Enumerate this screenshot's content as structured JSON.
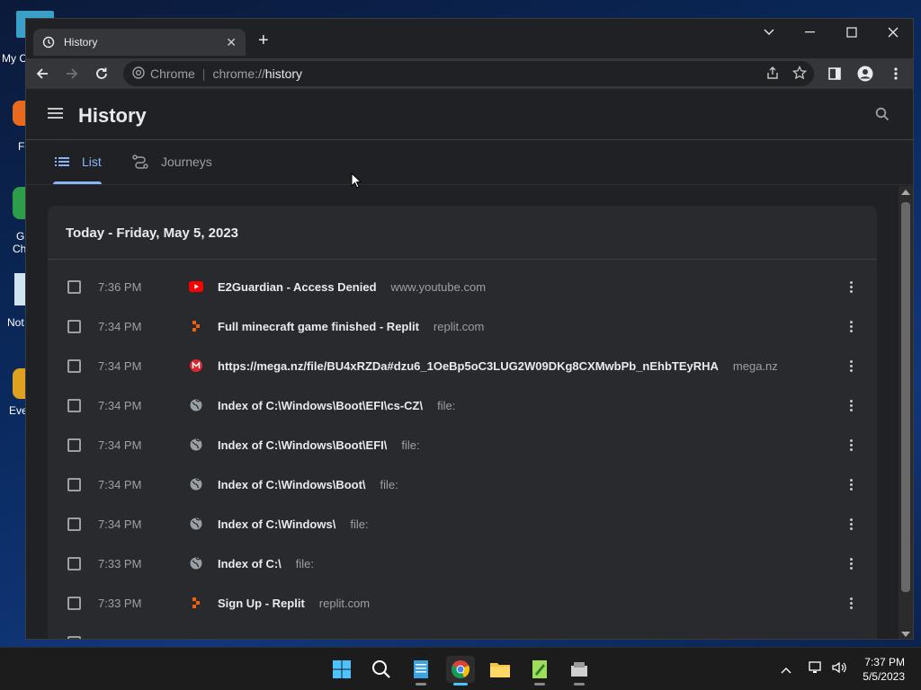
{
  "desktop": {
    "labels": [
      "My C",
      "F",
      "G",
      "Ch",
      "Not",
      "Eve"
    ]
  },
  "browser": {
    "tab_title": "History",
    "omnibox": {
      "site_label": "Chrome",
      "url_scheme": "chrome://",
      "url_host": "history"
    }
  },
  "history": {
    "page_title": "History",
    "tabs": [
      {
        "label": "List",
        "active": true
      },
      {
        "label": "Journeys",
        "active": false
      }
    ],
    "date_heading": "Today - Friday, May 5, 2023",
    "entries": [
      {
        "time": "7:36 PM",
        "title": "E2Guardian - Access Denied",
        "domain": "www.youtube.com",
        "icon": "youtube-icon"
      },
      {
        "time": "7:34 PM",
        "title": "Full minecraft game finished - Replit",
        "domain": "replit.com",
        "icon": "replit-icon"
      },
      {
        "time": "7:34 PM",
        "title": "https://mega.nz/file/BU4xRZDa#dzu6_1OeBp5oC3LUG2W09DKg8CXMwbPb_nEhbTEyRHA",
        "domain": "mega.nz",
        "icon": "mega-icon"
      },
      {
        "time": "7:34 PM",
        "title": "Index of C:\\Windows\\Boot\\EFI\\cs-CZ\\",
        "domain": "file:",
        "icon": "globe-icon"
      },
      {
        "time": "7:34 PM",
        "title": "Index of C:\\Windows\\Boot\\EFI\\",
        "domain": "file:",
        "icon": "globe-icon"
      },
      {
        "time": "7:34 PM",
        "title": "Index of C:\\Windows\\Boot\\",
        "domain": "file:",
        "icon": "globe-icon"
      },
      {
        "time": "7:34 PM",
        "title": "Index of C:\\Windows\\",
        "domain": "file:",
        "icon": "globe-icon"
      },
      {
        "time": "7:33 PM",
        "title": "Index of C:\\",
        "domain": "file:",
        "icon": "globe-icon"
      },
      {
        "time": "7:33 PM",
        "title": "Sign Up - Replit",
        "domain": "replit.com",
        "icon": "replit-icon"
      }
    ]
  },
  "taskbar": {
    "time": "7:37 PM",
    "date": "5/5/2023"
  },
  "colors": {
    "accent": "#8ab4f8",
    "page_bg": "#202124",
    "card_bg": "#292a2d"
  }
}
